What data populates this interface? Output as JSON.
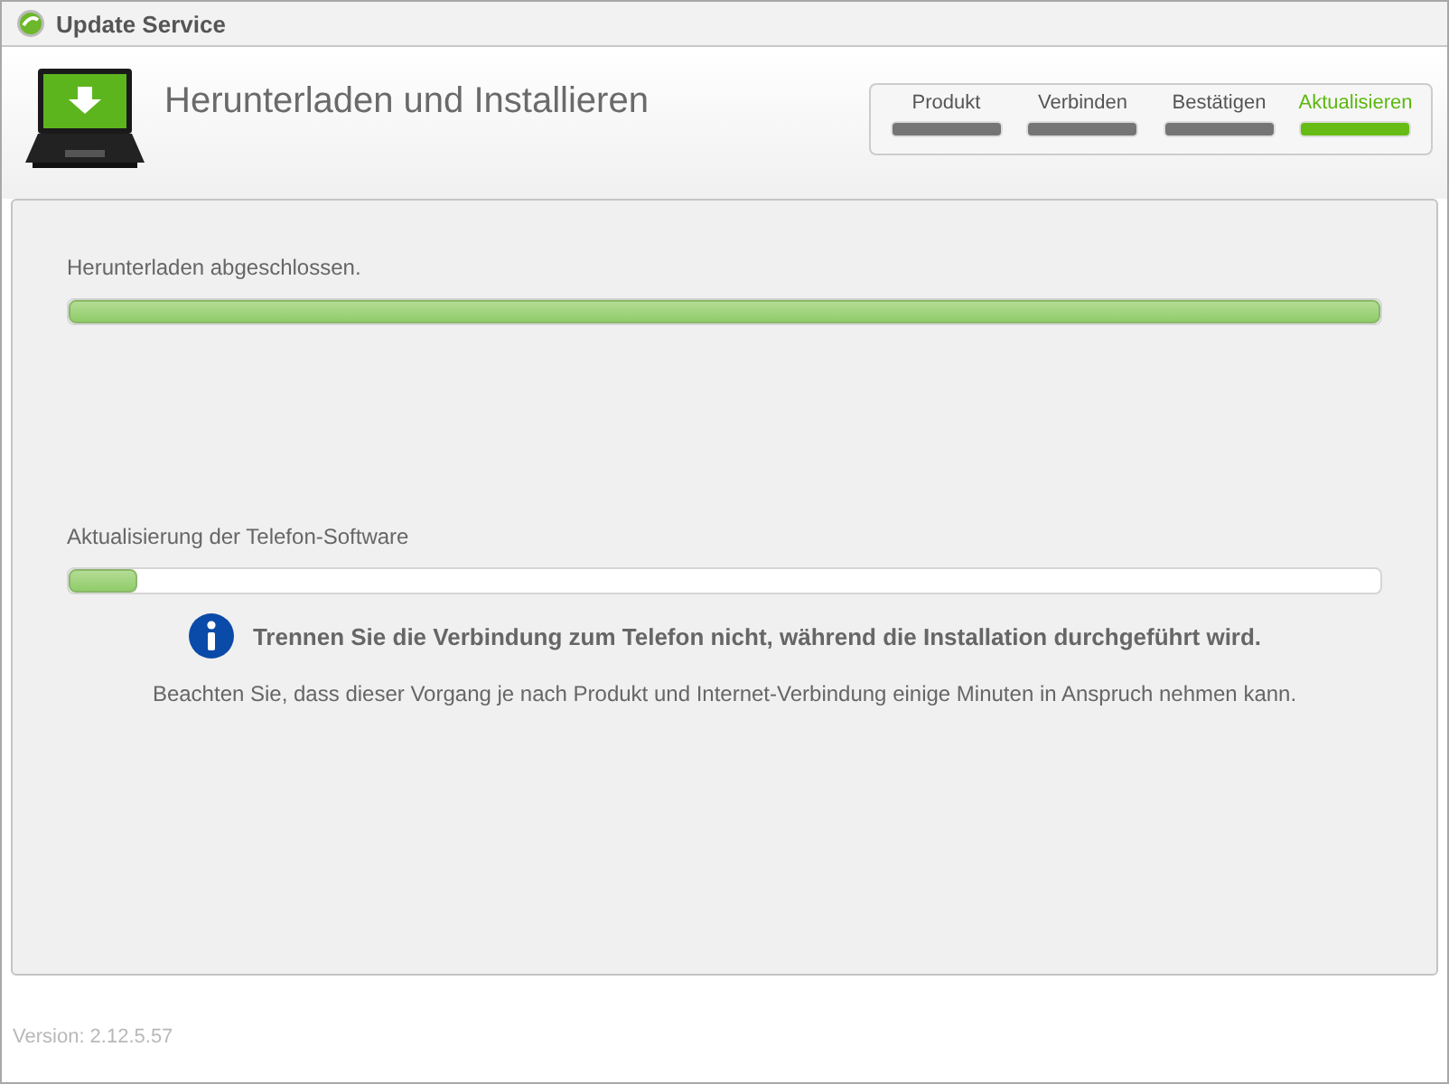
{
  "window": {
    "title": "Update Service"
  },
  "header": {
    "title": "Herunterladen und Installieren"
  },
  "steps": [
    {
      "label": "Produkt",
      "selected": false
    },
    {
      "label": "Verbinden",
      "selected": false
    },
    {
      "label": "Bestätigen",
      "selected": false
    },
    {
      "label": "Aktualisieren",
      "selected": true
    }
  ],
  "tasks": [
    {
      "label": "Herunterladen abgeschlossen.",
      "level": 1
    },
    {
      "label": "Aktualisierung der Telefon-Software",
      "level": 0.03
    }
  ],
  "notice": {
    "warning": "Trennen Sie die Verbindung zum Telefon nicht, während die Installation durchgeführt wird.",
    "note": "Beachten Sie, dass dieser Vorgang je nach Produkt und Internet-Verbindung einige Minuten in Anspruch nehmen kann."
  },
  "footer": {
    "version": "Version: 2.12.5.57"
  }
}
